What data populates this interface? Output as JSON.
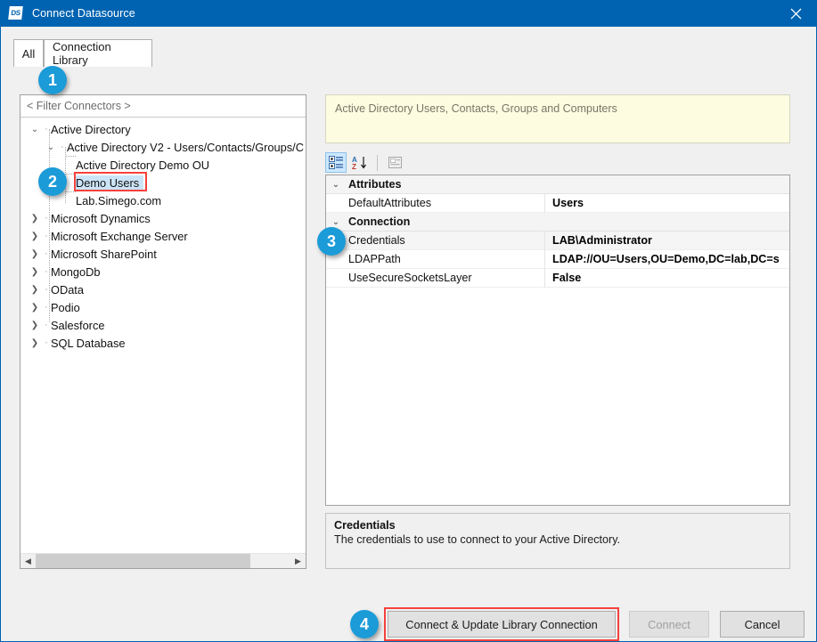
{
  "window": {
    "title": "Connect Datasource",
    "app_icon": "simego-datasync-icon",
    "icon_text": "DS",
    "close_icon": "close-icon",
    "accent_color": "#0063b1"
  },
  "tabs": [
    {
      "label": "All",
      "selected": false
    },
    {
      "label": "Connection Library",
      "selected": true
    }
  ],
  "left_panel": {
    "filter": {
      "placeholder": "< Filter Connectors >",
      "value": "< Filter Connectors >"
    },
    "tree": [
      {
        "label": "Active Directory",
        "level": 0,
        "state": "expanded",
        "selected": false
      },
      {
        "label": "Active Directory V2 - Users/Contacts/Groups/C",
        "level": 1,
        "state": "expanded",
        "selected": false
      },
      {
        "label": "Active Directory Demo OU",
        "level": 2,
        "state": "leaf",
        "selected": false
      },
      {
        "label": "Demo Users",
        "level": 2,
        "state": "leaf",
        "selected": true
      },
      {
        "label": "Lab.Simego.com",
        "level": 2,
        "state": "leaf",
        "selected": false
      },
      {
        "label": "Microsoft Dynamics",
        "level": 0,
        "state": "collapsed",
        "selected": false
      },
      {
        "label": "Microsoft Exchange Server",
        "level": 0,
        "state": "collapsed",
        "selected": false
      },
      {
        "label": "Microsoft SharePoint",
        "level": 0,
        "state": "collapsed",
        "selected": false
      },
      {
        "label": "MongoDb",
        "level": 0,
        "state": "collapsed",
        "selected": false
      },
      {
        "label": "OData",
        "level": 0,
        "state": "collapsed",
        "selected": false
      },
      {
        "label": "Podio",
        "level": 0,
        "state": "collapsed",
        "selected": false
      },
      {
        "label": "Salesforce",
        "level": 0,
        "state": "collapsed",
        "selected": false
      },
      {
        "label": "SQL Database",
        "level": 0,
        "state": "collapsed",
        "selected": false
      }
    ],
    "scrollbar": {
      "left_arrow": "chevron-left-icon",
      "right_arrow": "chevron-right-icon"
    }
  },
  "right_panel": {
    "header_description": "Active Directory Users, Contacts, Groups and Computers",
    "toolbar": [
      {
        "name": "categorized-view-button",
        "icon": "categorized-icon",
        "active": true
      },
      {
        "name": "alphabetical-sort-button",
        "icon": "sort-az-icon",
        "active": false
      },
      {
        "name": "property-pages-button",
        "icon": "property-pages-icon",
        "active": false
      }
    ],
    "properties": [
      {
        "kind": "category",
        "name": "Attributes",
        "value": "",
        "expanded": true,
        "selected": false
      },
      {
        "kind": "property",
        "name": "DefaultAttributes",
        "value": "Users",
        "selected": false
      },
      {
        "kind": "category",
        "name": "Connection",
        "value": "",
        "expanded": true,
        "selected": false
      },
      {
        "kind": "property",
        "name": "Credentials",
        "value": "LAB\\Administrator",
        "selected": true
      },
      {
        "kind": "property",
        "name": "LDAPPath",
        "value": "LDAP://OU=Users,OU=Demo,DC=lab,DC=s",
        "selected": false
      },
      {
        "kind": "property",
        "name": "UseSecureSocketsLayer",
        "value": "False",
        "selected": false
      }
    ],
    "description": {
      "title": "Credentials",
      "text": "The credentials to use to connect to your Active Directory."
    }
  },
  "buttons": {
    "update": {
      "label": "Connect & Update Library Connection",
      "enabled": true
    },
    "connect": {
      "label": "Connect",
      "enabled": false
    },
    "cancel": {
      "label": "Cancel",
      "enabled": true
    }
  },
  "annotations": {
    "highlight_color": "#f4423c",
    "badge_color": "#1b9bd8",
    "badges": [
      {
        "number": "1",
        "target": "connection-library-tab"
      },
      {
        "number": "2",
        "target": "tree-item-demo-users"
      },
      {
        "number": "3",
        "target": "property-credentials"
      },
      {
        "number": "4",
        "target": "connect-update-library-connection-button"
      }
    ]
  }
}
